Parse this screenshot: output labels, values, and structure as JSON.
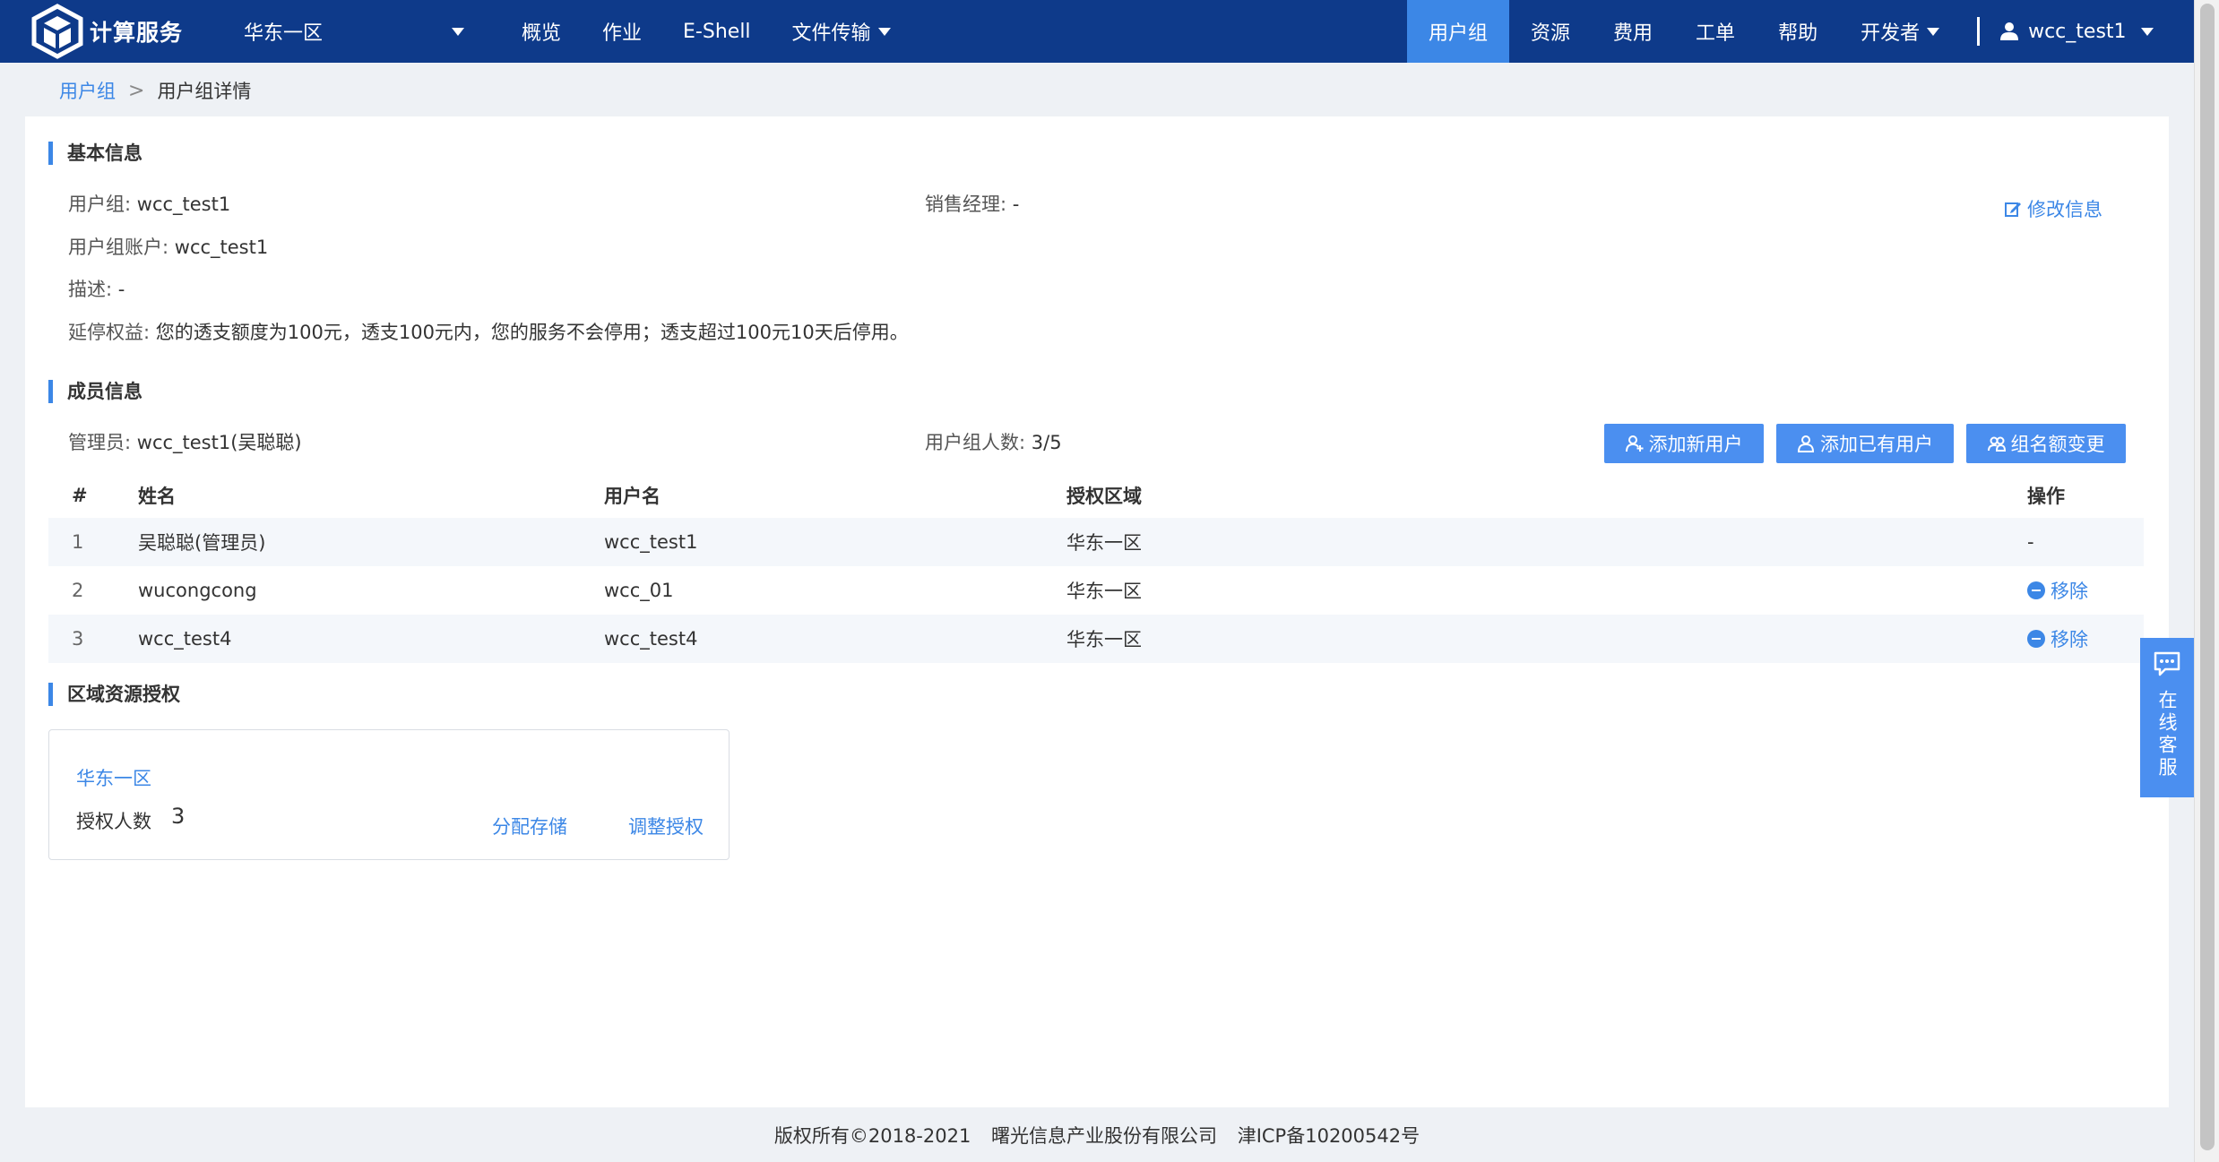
{
  "header": {
    "logo_text": "计算服务",
    "region": "华东一区",
    "nav_left": [
      "概览",
      "作业",
      "E-Shell",
      "文件传输"
    ],
    "nav_right": [
      "用户组",
      "资源",
      "费用",
      "工单",
      "帮助",
      "开发者"
    ],
    "active_nav": "用户组",
    "username": "wcc_test1"
  },
  "breadcrumb": {
    "parent": "用户组",
    "current": "用户组详情"
  },
  "basic_info": {
    "title": "基本信息",
    "group_label": "用户组:",
    "group_value": "wcc_test1",
    "sales_label": "销售经理:",
    "sales_value": "-",
    "account_label": "用户组账户:",
    "account_value": "wcc_test1",
    "desc_label": "描述:",
    "desc_value": "-",
    "extend_label": "延停权益:",
    "extend_value": "您的透支额度为100元，透支100元内，您的服务不会停用；透支超过100元10天后停用。",
    "edit_label": "修改信息"
  },
  "member_info": {
    "title": "成员信息",
    "admin_label": "管理员:",
    "admin_value": "wcc_test1(吴聪聪)",
    "count_label": "用户组人数:",
    "count_value": "3/5",
    "buttons": {
      "add_new": "添加新用户",
      "add_existing": "添加已有用户",
      "quota_change": "组名额变更"
    },
    "columns": [
      "#",
      "姓名",
      "用户名",
      "授权区域",
      "操作"
    ],
    "rows": [
      {
        "idx": "1",
        "name": "吴聪聪(管理员)",
        "username": "wcc_test1",
        "region": "华东一区",
        "op": "-"
      },
      {
        "idx": "2",
        "name": "wucongcong",
        "username": "wcc_01",
        "region": "华东一区",
        "op": "移除"
      },
      {
        "idx": "3",
        "name": "wcc_test4",
        "username": "wcc_test4",
        "region": "华东一区",
        "op": "移除"
      }
    ]
  },
  "region_auth": {
    "title": "区域资源授权",
    "card": {
      "region": "华东一区",
      "auth_count_label": "授权人数",
      "auth_count_value": "3",
      "allocate_storage": "分配存储",
      "adjust_auth": "调整授权"
    }
  },
  "footer": {
    "copyright": "版权所有©2018-2021",
    "company": "曙光信息产业股份有限公司",
    "icp": "津ICP备10200542号"
  },
  "service": {
    "label": "在线客服"
  }
}
